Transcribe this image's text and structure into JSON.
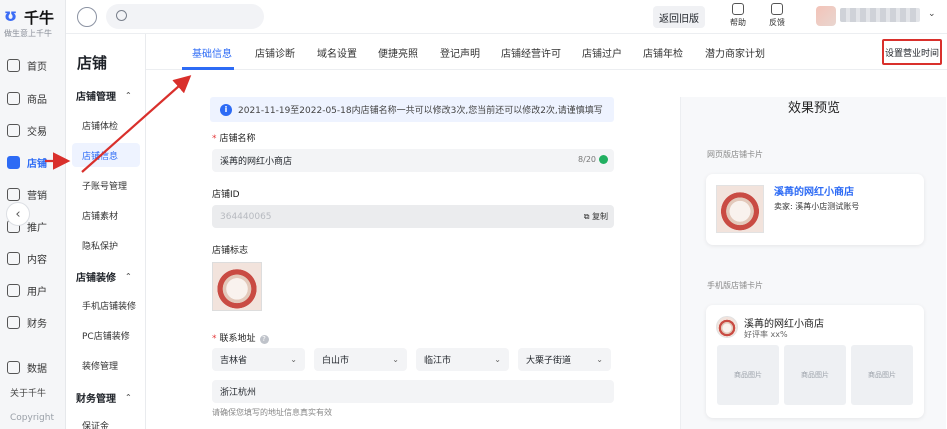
{
  "brand": {
    "name": "千牛",
    "logo_glyph": "ʊ",
    "tagline": "做生意上千牛"
  },
  "rail": {
    "items": [
      {
        "label": "首页",
        "icon": "home-icon"
      },
      {
        "label": "商品",
        "icon": "product-icon"
      },
      {
        "label": "交易",
        "icon": "trade-icon"
      },
      {
        "label": "店铺",
        "icon": "store-icon",
        "active": true
      },
      {
        "label": "营销",
        "icon": "marketing-icon"
      },
      {
        "label": "推广",
        "icon": "promotion-icon"
      },
      {
        "label": "内容",
        "icon": "content-icon"
      },
      {
        "label": "用户",
        "icon": "user-icon"
      },
      {
        "label": "财务",
        "icon": "finance-icon"
      },
      {
        "label": "数据",
        "icon": "data-icon"
      }
    ],
    "about": "关于千牛",
    "copyright": "Copyright",
    "collapse_glyph": "‹"
  },
  "subnav": {
    "title": "店铺",
    "groups": [
      {
        "label": "店铺管理",
        "items": [
          "店铺体检",
          "店铺信息",
          "子账号管理",
          "店铺素材",
          "隐私保护"
        ]
      },
      {
        "label": "店铺装修",
        "items": [
          "手机店铺装修",
          "PC店铺装修",
          "装修管理"
        ]
      },
      {
        "label": "财务管理",
        "items": [
          "保证金"
        ]
      }
    ],
    "caret": "⌃"
  },
  "topbar": {
    "old_version": "返回旧版",
    "help": "帮助",
    "feedback": "反馈",
    "user_caret": "⌄"
  },
  "tabs": {
    "items": [
      "基础信息",
      "店铺诊断",
      "域名设置",
      "便捷亮照",
      "登记声明",
      "店铺经营许可",
      "店铺过户",
      "店铺年检",
      "潜力商家计划"
    ],
    "active_index": 0,
    "hours_button": "设置营业时间"
  },
  "form": {
    "notice_icon": "i",
    "notice": "2021-11-19至2022-05-18内店铺名称一共可以修改3次,您当前还可以修改2次,请谨慎填写",
    "req_mark": "*",
    "name_label": "店铺名称",
    "name_value": "溪苒的网红小商店",
    "name_counter": "8/20",
    "id_label": "店铺ID",
    "id_value": "364440065",
    "copy_label": "⧉ 复制",
    "logo_label": "店铺标志",
    "address_label": "联系地址",
    "help_glyph": "?",
    "province": "吉林省",
    "city": "白山市",
    "district": "临江市",
    "street": "大栗子街道",
    "select_arrow": "⌄",
    "address_detail": "浙江杭州",
    "address_hint": "请确保您填写的地址信息真实有效"
  },
  "preview": {
    "title": "效果预览",
    "web_label": "网页版店铺卡片",
    "mobile_label": "手机版店铺卡片",
    "shop_name": "溪苒的网红小商店",
    "seller": "卖家: 溪苒小店测试账号",
    "rating": "好评率 xx%",
    "placeholder": "商品图片"
  },
  "colors": {
    "accent": "#2d6bf5",
    "annotation": "#d9302c"
  }
}
